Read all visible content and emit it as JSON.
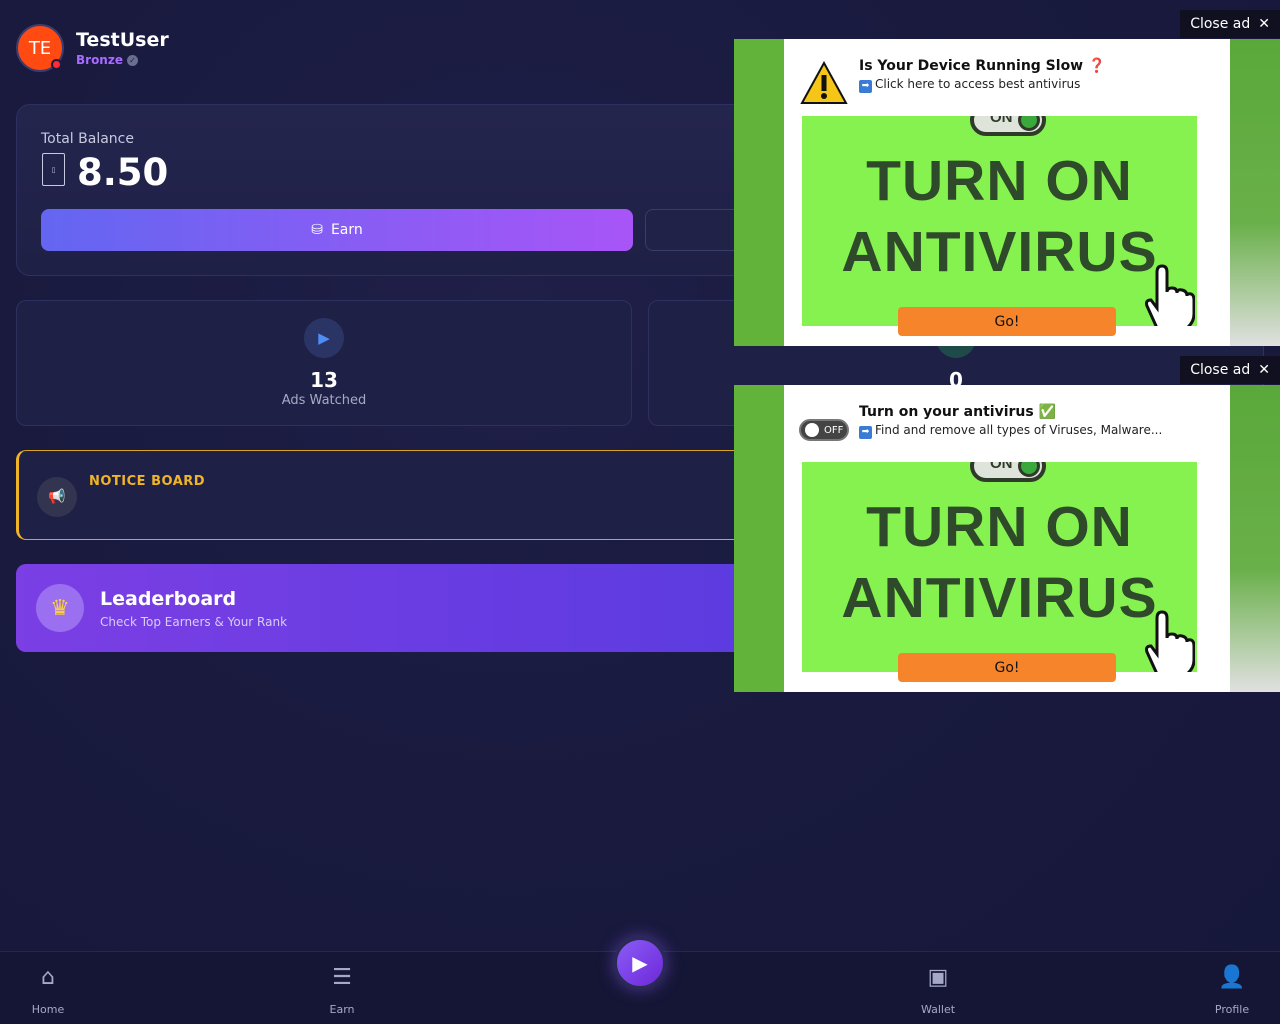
{
  "user": {
    "initials": "TE",
    "name": "TestUser",
    "tier": "Bronze"
  },
  "balance": {
    "label": "Total Balance",
    "value": "8.50",
    "earn_label": "Earn"
  },
  "stats": [
    {
      "value": "13",
      "label": "Ads Watched"
    },
    {
      "value": "0",
      "label": ""
    }
  ],
  "notice": {
    "title": "NOTICE BOARD"
  },
  "leaderboard": {
    "title": "Leaderboard",
    "subtitle": "Check Top Earners & Your Rank"
  },
  "nav": {
    "home": "Home",
    "earn": "Earn",
    "wallet": "Wallet",
    "profile": "Profile"
  },
  "ads": [
    {
      "close_label": "Close ad",
      "title": "Is Your Device Running Slow ❓",
      "subtitle": "Click here to access best antivirus",
      "banner_line1": "TURN ON",
      "banner_line2": "ANTIVIRUS",
      "banner_switch": "ON",
      "go_label": "Go!"
    },
    {
      "close_label": "Close ad",
      "title": "Turn on your antivirus ✅",
      "subtitle": "Find and remove all types of Viruses, Malware...",
      "toggle_label": "OFF",
      "banner_line1": "TURN ON",
      "banner_line2": "ANTIVIRUS",
      "banner_switch": "ON",
      "go_label": "Go!"
    }
  ],
  "colors": {
    "accent": "#8b5cf6",
    "notice": "#f0b526",
    "avatar": "#ff4a12",
    "go_button": "#f5842b",
    "banner": "#86f24f"
  }
}
